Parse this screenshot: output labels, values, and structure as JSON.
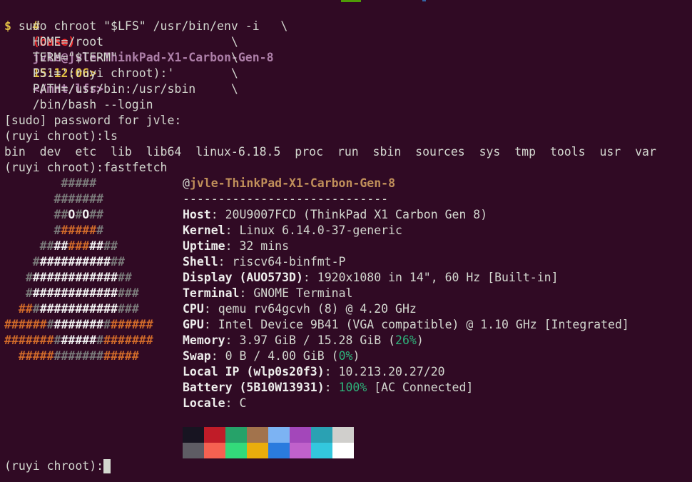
{
  "window": {
    "background": "#300a24"
  },
  "prompt": {
    "hash": "#",
    "env": "(base)",
    "user_host": "jvle@jvle-ThinkPad-X1-Carbon-Gen-8",
    "time": "15:12:06>",
    "path": "</mnt/lfs>",
    "dollar": "$"
  },
  "lines": {
    "cmd1": " sudo chroot \"$LFS\" /usr/bin/env -i   \\",
    "cmd2": "    HOME=/root                  \\",
    "cmd3": "    TERM=\"$TERM\"                \\",
    "cmd4": "    PS1='(ruyi chroot):'        \\",
    "cmd5": "    PATH=/usr/bin:/usr/sbin     \\",
    "cmd6": "    /bin/bash --login",
    "sudo": "[sudo] password for jvle:",
    "ls_prompt": "(ruyi chroot):ls",
    "ls_output": "bin  dev  etc  lib  lib64  linux-6.18.5  proc  run  sbin  sources  sys  tmp  tools  usr  var",
    "ff_prompt": "(ruyi chroot):fastfetch",
    "final_prompt": "(ruyi chroot):"
  },
  "fastfetch": {
    "at": "@",
    "host_title": "jvle-ThinkPad-X1-Carbon-Gen-8",
    "separator": "-----------------------------",
    "host_key": "Host",
    "host_val": "20U9007FCD (ThinkPad X1 Carbon Gen 8)",
    "kernel_key": "Kernel",
    "kernel_val": "Linux 6.14.0-37-generic",
    "uptime_key": "Uptime",
    "uptime_val": "32 mins",
    "shell_key": "Shell",
    "shell_val": "riscv64-binfmt-P",
    "display_key": "Display (AUO573D)",
    "display_val": "1920x1080 in 14\", 60 Hz [Built-in]",
    "terminal_key": "Terminal",
    "terminal_val": "GNOME Terminal",
    "cpu_key": "CPU",
    "cpu_val": "qemu rv64gcvh (8) @ 4.20 GHz",
    "gpu_key": "GPU",
    "gpu_val": "Intel Device 9B41 (VGA compatible) @ 1.10 GHz [Integrated]",
    "memory_key": "Memory",
    "memory_val": "3.97 GiB / 15.28 GiB (",
    "memory_pct": "26%",
    "memory_end": ")",
    "swap_key": "Swap",
    "swap_val": "0 B / 4.00 GiB (",
    "swap_pct": "0%",
    "swap_end": ")",
    "localip_key": "Local IP (wlp0s20f3)",
    "localip_val": "10.213.20.27/20",
    "battery_key": "Battery (5B10W13931)",
    "battery_pct": "100%",
    "battery_val": " [AC Connected]",
    "locale_key": "Locale",
    "locale_val": "C",
    "colon": ": ",
    "palette_top": [
      "#171421",
      "#c01c28",
      "#26a269",
      "#a2734c",
      "#7cb3f3",
      "#a347ba",
      "#2aa1b3",
      "#d0cfcc"
    ],
    "palette_bottom": [
      "#5e5c64",
      "#f66151",
      "#33da7a",
      "#e9ad0c",
      "#2a7bde",
      "#c061cb",
      "#33c7de",
      "#ffffff"
    ]
  },
  "logo": [
    [
      [
        "        ",
        "ld"
      ],
      [
        "#####",
        "ld"
      ]
    ],
    [
      [
        "       ",
        "ld"
      ],
      [
        "#######",
        "ld"
      ]
    ],
    [
      [
        "       ",
        "ld"
      ],
      [
        "##",
        "ld"
      ],
      [
        "O",
        "lw"
      ],
      [
        "#",
        "ld"
      ],
      [
        "O",
        "lw"
      ],
      [
        "##",
        "ld"
      ]
    ],
    [
      [
        "       ",
        "ld"
      ],
      [
        "#",
        "ld"
      ],
      [
        "#####",
        "lo"
      ],
      [
        "#",
        "ld"
      ]
    ],
    [
      [
        "     ",
        "ld"
      ],
      [
        "##",
        "ld"
      ],
      [
        "##",
        "lw"
      ],
      [
        "###",
        "lo"
      ],
      [
        "##",
        "lw"
      ],
      [
        "##",
        "ld"
      ]
    ],
    [
      [
        "    ",
        "ld"
      ],
      [
        "#",
        "ld"
      ],
      [
        "##########",
        "lw"
      ],
      [
        "##",
        "ld"
      ]
    ],
    [
      [
        "   ",
        "ld"
      ],
      [
        "#",
        "ld"
      ],
      [
        "############",
        "lw"
      ],
      [
        "##",
        "ld"
      ]
    ],
    [
      [
        "   ",
        "ld"
      ],
      [
        "#",
        "ld"
      ],
      [
        "############",
        "lw"
      ],
      [
        "###",
        "ld"
      ]
    ],
    [
      [
        "  ",
        "ld"
      ],
      [
        "##",
        "lo"
      ],
      [
        "#",
        "ld"
      ],
      [
        "###########",
        "lw"
      ],
      [
        "###",
        "ld"
      ]
    ],
    [
      [
        "",
        "ld"
      ],
      [
        "######",
        "lo"
      ],
      [
        "#",
        "ld"
      ],
      [
        "#######",
        "lw"
      ],
      [
        "#",
        "ld"
      ],
      [
        "######",
        "lo"
      ]
    ],
    [
      [
        "",
        "ld"
      ],
      [
        "#######",
        "lo"
      ],
      [
        "#",
        "ld"
      ],
      [
        "#####",
        "lw"
      ],
      [
        "#",
        "ld"
      ],
      [
        "#######",
        "lo"
      ]
    ],
    [
      [
        "  ",
        "ld"
      ],
      [
        "#####",
        "lo"
      ],
      [
        "#######",
        "ld"
      ],
      [
        "#####",
        "lo"
      ]
    ]
  ]
}
